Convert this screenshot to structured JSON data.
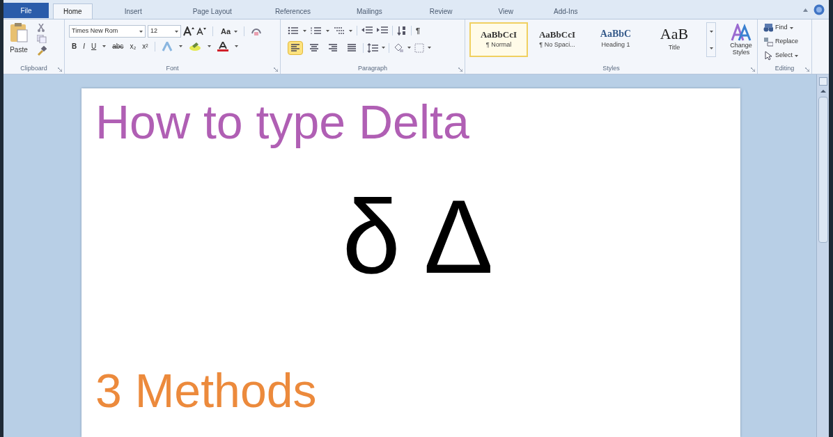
{
  "tabs": [
    {
      "label": "File",
      "kind": "file",
      "selected": false
    },
    {
      "label": "Home",
      "kind": "tab",
      "selected": true
    },
    {
      "label": "Insert",
      "kind": "tab",
      "selected": false
    },
    {
      "label": "Page Layout",
      "kind": "tab",
      "selected": false
    },
    {
      "label": "References",
      "kind": "tab",
      "selected": false
    },
    {
      "label": "Mailings",
      "kind": "tab",
      "selected": false
    },
    {
      "label": "Review",
      "kind": "tab",
      "selected": false
    },
    {
      "label": "View",
      "kind": "tab",
      "selected": false
    },
    {
      "label": "Add-Ins",
      "kind": "tab",
      "selected": false
    }
  ],
  "clipboard": {
    "paste_label": "Paste",
    "group_label": "Clipboard"
  },
  "font": {
    "font_name": "Times New Rom",
    "font_size": "12",
    "case_label": "Aa",
    "format_buttons": [
      "B",
      "I",
      "U",
      "abc",
      "x₂",
      "x²"
    ],
    "group_label": "Font"
  },
  "paragraph": {
    "pilcrow": "¶",
    "alignments": [
      {
        "kind": "left",
        "selected": true
      },
      {
        "kind": "center",
        "selected": false
      },
      {
        "kind": "right",
        "selected": false
      },
      {
        "kind": "justify",
        "selected": false
      }
    ],
    "group_label": "Paragraph"
  },
  "styles": {
    "items": [
      {
        "sample": "AaBbCcI",
        "label": "¶ Normal",
        "kind": "normal",
        "selected": true
      },
      {
        "sample": "AaBbCcI",
        "label": "¶ No Spaci...",
        "kind": "normal",
        "selected": false
      },
      {
        "sample": "AaBbC",
        "label": "Heading 1",
        "kind": "heading",
        "selected": false
      },
      {
        "sample": "AaB",
        "label": "Title",
        "kind": "title",
        "selected": false
      }
    ],
    "change_styles": "Change Styles",
    "group_label": "Styles"
  },
  "editing": {
    "buttons": [
      {
        "label": "Find",
        "dropdown": true
      },
      {
        "label": "Replace",
        "dropdown": false
      },
      {
        "label": "Select",
        "dropdown": true
      }
    ],
    "group_label": "Editing"
  },
  "document": {
    "lines": [
      {
        "kind": "title",
        "text": "How to type Delta"
      },
      {
        "kind": "symbols",
        "text": "δ Δ"
      },
      {
        "kind": "subtitle",
        "text": "3 Methods"
      }
    ]
  }
}
